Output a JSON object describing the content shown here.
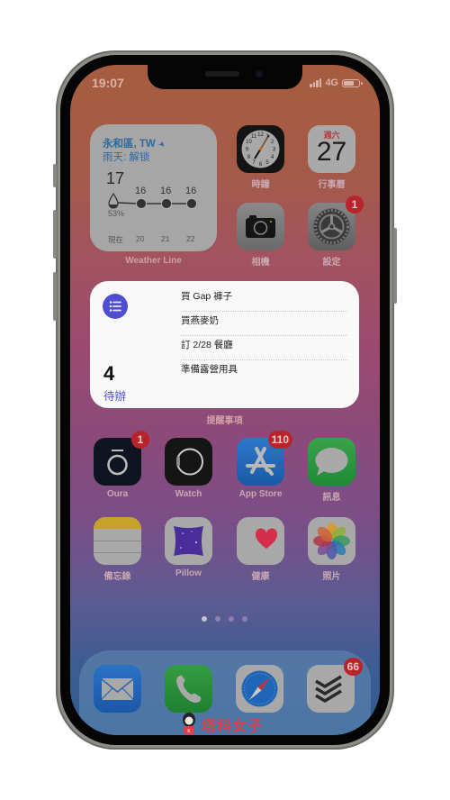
{
  "status_bar": {
    "time": "19:07",
    "network": "4G",
    "battery_level": 0.7
  },
  "weather_widget": {
    "location": "永和區, TW",
    "condition": "雨天: 解锁",
    "current_temp": "17",
    "precip_chance": "53%",
    "forecast_temps": [
      "16",
      "16",
      "16"
    ],
    "axis_labels": [
      "現在",
      "20",
      "21",
      "22"
    ],
    "app_label": "Weather Line"
  },
  "top_apps": [
    {
      "name": "時鐘",
      "icon": "clock-icon"
    },
    {
      "name": "行事曆",
      "icon": "calendar-icon",
      "weekday": "週六",
      "day": "27"
    },
    {
      "name": "相機",
      "icon": "camera-icon"
    },
    {
      "name": "設定",
      "icon": "settings-gear-icon",
      "badge": "1"
    }
  ],
  "reminders_widget": {
    "count": "4",
    "list_label": "待辦",
    "items": [
      "買 Gap 褲子",
      "買燕麥奶",
      "訂 2/28 餐廳",
      "準備露營用具"
    ],
    "app_label": "提醒事項",
    "accent_color": "#4e4ed1"
  },
  "app_rows": [
    [
      {
        "name": "Oura",
        "icon": "oura-ring-icon",
        "badge": "1"
      },
      {
        "name": "Watch",
        "icon": "watch-icon"
      },
      {
        "name": "App Store",
        "icon": "app-store-icon",
        "badge": "110"
      },
      {
        "name": "訊息",
        "icon": "messages-icon"
      }
    ],
    [
      {
        "name": "備忘錄",
        "icon": "notes-icon"
      },
      {
        "name": "Pillow",
        "icon": "pillow-icon"
      },
      {
        "name": "健康",
        "icon": "health-heart-icon"
      },
      {
        "name": "照片",
        "icon": "photos-icon"
      }
    ]
  ],
  "page_indicator": {
    "total": 4,
    "active": 1
  },
  "dock": [
    {
      "name": "Mail",
      "icon": "mail-icon"
    },
    {
      "name": "Phone",
      "icon": "phone-icon"
    },
    {
      "name": "Safari",
      "icon": "safari-compass-icon"
    },
    {
      "name": "Todoist",
      "icon": "todoist-icon",
      "badge": "66"
    }
  ],
  "watermark": {
    "text": "塔科女子"
  }
}
